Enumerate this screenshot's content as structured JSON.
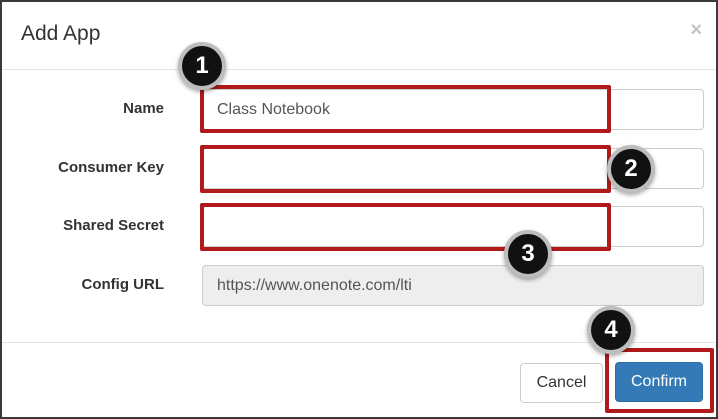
{
  "dialog": {
    "title": "Add App",
    "close_glyph": "×"
  },
  "form": {
    "name": {
      "label": "Name",
      "value": "Class Notebook"
    },
    "consumer_key": {
      "label": "Consumer Key",
      "value": ""
    },
    "shared_secret": {
      "label": "Shared Secret",
      "value": ""
    },
    "config_url": {
      "label": "Config URL",
      "value": "https://www.onenote.com/lti"
    }
  },
  "footer": {
    "cancel_label": "Cancel",
    "confirm_label": "Confirm"
  },
  "callouts": [
    "1",
    "2",
    "3",
    "4"
  ],
  "colors": {
    "callout_border": "#b01a1a",
    "badge_fill": "#111111",
    "confirm_button": "#337ab7"
  }
}
